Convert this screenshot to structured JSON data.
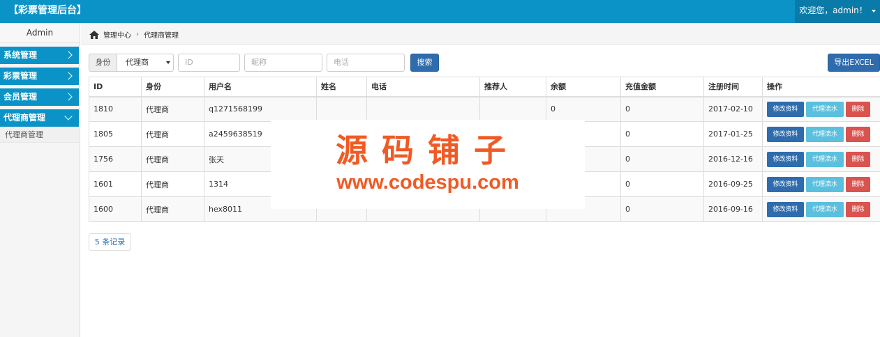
{
  "header": {
    "brand": "【彩票管理后台】",
    "welcome": "欢迎您，admin！"
  },
  "sidebar": {
    "user": "Admin",
    "groups": [
      {
        "label": "系统管理",
        "expanded": false
      },
      {
        "label": "彩票管理",
        "expanded": false
      },
      {
        "label": "会员管理",
        "expanded": false
      },
      {
        "label": "代理商管理",
        "expanded": true
      }
    ],
    "subitems": [
      {
        "label": "代理商管理"
      }
    ]
  },
  "breadcrumb": {
    "home_icon": "home-icon",
    "root": "管理中心",
    "current": "代理商管理"
  },
  "filters": {
    "role_label": "身份",
    "role_value": "代理商",
    "id_placeholder": "ID",
    "nickname_placeholder": "昵称",
    "phone_placeholder": "电话",
    "search_label": "搜索",
    "export_label": "导出EXCEL"
  },
  "table": {
    "headers": [
      "ID",
      "身份",
      "用户名",
      "姓名",
      "电话",
      "推荐人",
      "余额",
      "充值金额",
      "注册时间",
      "操作"
    ],
    "rows": [
      {
        "id": "1810",
        "role": "代理商",
        "username": "q1271568199",
        "name": "",
        "phone": "",
        "referrer": "",
        "balance": "0",
        "recharge": "0",
        "reg_date": "2017-02-10"
      },
      {
        "id": "1805",
        "role": "代理商",
        "username": "a2459638519",
        "name": "",
        "phone": "",
        "referrer": "",
        "balance": "",
        "recharge": "0",
        "reg_date": "2017-01-25"
      },
      {
        "id": "1756",
        "role": "代理商",
        "username": "张天",
        "name": "",
        "phone": "",
        "referrer": "",
        "balance": "",
        "recharge": "0",
        "reg_date": "2016-12-16"
      },
      {
        "id": "1601",
        "role": "代理商",
        "username": "1314",
        "name": "",
        "phone": "",
        "referrer": "",
        "balance": "",
        "recharge": "0",
        "reg_date": "2016-09-25"
      },
      {
        "id": "1600",
        "role": "代理商",
        "username": "hex8011",
        "name": "",
        "phone": "",
        "referrer": "",
        "balance": "",
        "recharge": "0",
        "reg_date": "2016-09-16"
      }
    ],
    "actions": {
      "edit": "修改资料",
      "flow": "代理流水",
      "delete": "删除"
    }
  },
  "pagination": {
    "count_label": "5 条记录"
  },
  "watermark": {
    "title": "源码铺子",
    "url": "www.codespu.com"
  },
  "colors": {
    "primary": "#0b93c8",
    "button_blue": "#2f6cad",
    "button_info": "#5bc0de",
    "button_danger": "#d9534f",
    "watermark": "#f05a24"
  }
}
